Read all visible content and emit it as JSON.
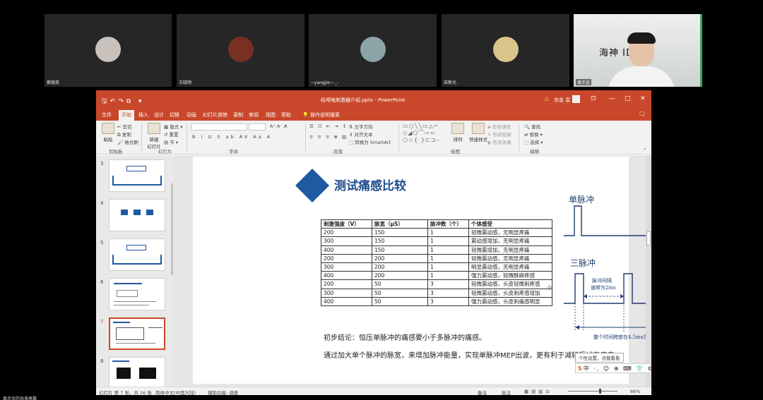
{
  "participants": [
    {
      "name": "崔丽英"
    },
    {
      "name": "王晓明"
    },
    {
      "name": "~yangjie~-_-"
    },
    {
      "name": "宋新光"
    },
    {
      "name": "袁亦金"
    }
  ],
  "video_wall_text": "海神  IDON",
  "ppt": {
    "doc_title": "经颅电刺激器介绍.pptx - PowerPoint",
    "user": "亦金 袁",
    "window_buttons": [
      "⊡",
      "—",
      "□",
      "✕"
    ],
    "menu_tabs": [
      "文件",
      "开始",
      "插入",
      "设计",
      "切换",
      "动画",
      "幻灯片放映",
      "录制",
      "审阅",
      "视图",
      "帮助"
    ],
    "active_tab": "开始",
    "tell_me": "操作说明搜索",
    "ribbon": {
      "cut": "剪切",
      "copy": "复制",
      "format_painter": "格式刷",
      "paste": "粘贴",
      "new_slide": "新建\n幻灯片",
      "layout": "版式",
      "reset": "重置",
      "section": "节",
      "text_direction": "文字方向",
      "align_text": "对齐文本",
      "smartart": "转换为 SmartArt",
      "arrange": "排列",
      "quick_styles": "快速样式",
      "shape_fill": "形状填充",
      "shape_outline": "形状轮廓",
      "shape_effects": "形状效果",
      "find": "查找",
      "replace": "替换",
      "select": "选择",
      "groups": [
        "剪贴板",
        "幻灯片",
        "字体",
        "段落",
        "绘图",
        "编辑"
      ],
      "font_buttons": "B  I  U  S  ab  AV  Aa  A"
    },
    "thumbnails": [
      {
        "num": "3"
      },
      {
        "num": "4"
      },
      {
        "num": "5"
      },
      {
        "num": "6"
      },
      {
        "num": "7"
      },
      {
        "num": "8"
      }
    ],
    "active_slide": "7",
    "slide": {
      "title": "测试痛感比较",
      "table": {
        "headers": [
          "刺激强度（V）",
          "脉宽（μS）",
          "脉冲数（个）",
          "个体感受"
        ],
        "rows": [
          [
            "200",
            "150",
            "1",
            "轻微震动感，无明显疼痛"
          ],
          [
            "300",
            "150",
            "1",
            "震动感增加，无明显疼痛"
          ],
          [
            "400",
            "150",
            "1",
            "轻微震增加，无明显疼痛"
          ],
          [
            "200",
            "200",
            "1",
            "轻微震动感，无明显疼痛"
          ],
          [
            "300",
            "200",
            "1",
            "明显震动感，无明显疼痛"
          ],
          [
            "400",
            "200",
            "1",
            "强力震动感，轻微酥麻疼感"
          ],
          [
            "200",
            "50",
            "3",
            "轻微震动感，头皮轻微刺疼感"
          ],
          [
            "300",
            "50",
            "3",
            "轻微震动感，头皮刺疼感增加"
          ],
          [
            "400",
            "50",
            "3",
            "强力震动感，头皮刺痛感明显"
          ]
        ]
      },
      "conclusion_1": "初步结论：恒压单脉冲的痛感要小于多脉冲的痛感。",
      "conclusion_2": "通过加大单个脉冲的脉宽，来增加脉冲能量，实现单脉冲MEP出波，更有利于减轻受试者疼痛。",
      "single_pulse_label": "单脉冲",
      "triple_pulse_label": "三脉冲",
      "interval_label_1": "脉冲间隔",
      "interval_label_2": "通常为2ms",
      "span_label": "整个时间跨度在4.5ms左右"
    },
    "status": {
      "slide_info": "幻灯片 第 7 张，共 16 张",
      "language": "简体中文(中国大陆)",
      "accessibility": "辅助功能: 调查",
      "notes": "备注",
      "comments": "批注",
      "zoom": "86%"
    },
    "ime_tip": "个性设置，点我看看",
    "ime_bar": "中 ·, ☺ ⊕ ⌨ 👕 ⚙"
  },
  "share_notice": "袁亦金的共享屏幕",
  "colors": {
    "ppt_accent": "#c9482b",
    "title_blue": "#1f4e8e",
    "diamond_blue": "#1f5aa0",
    "wave_blue": "#1f3c6e"
  }
}
